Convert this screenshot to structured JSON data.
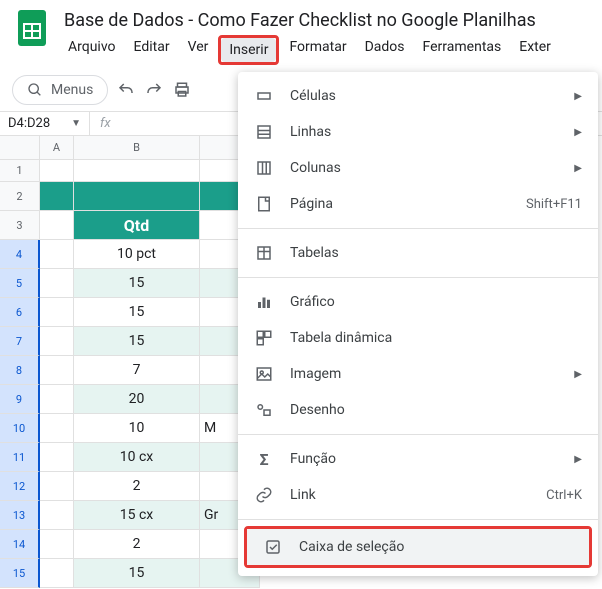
{
  "doc_title": "Base de Dados - Como Fazer Checklist no Google Planilhas",
  "menubar": {
    "arquivo": "Arquivo",
    "editar": "Editar",
    "ver": "Ver",
    "inserir": "Inserir",
    "formatar": "Formatar",
    "dados": "Dados",
    "ferramentas": "Ferramentas",
    "exter": "Exter"
  },
  "toolbar": {
    "menus": "Menus"
  },
  "namebox": "D4:D28",
  "fx_label": "fx",
  "columns": {
    "a": "A",
    "b": "B",
    "c": ""
  },
  "rows": [
    {
      "n": "1",
      "b": "",
      "c": "",
      "cls": "first"
    },
    {
      "n": "2",
      "b": "",
      "c": "",
      "cls": "row2"
    },
    {
      "n": "3",
      "b": "Qtd",
      "c": "",
      "cls": "hdr"
    },
    {
      "n": "4",
      "b": "10 pct",
      "c": "",
      "cls": "sel"
    },
    {
      "n": "5",
      "b": "15",
      "c": "",
      "cls": "sel teal"
    },
    {
      "n": "6",
      "b": "15",
      "c": "",
      "cls": "sel"
    },
    {
      "n": "7",
      "b": "15",
      "c": "",
      "cls": "sel teal"
    },
    {
      "n": "8",
      "b": "7",
      "c": "",
      "cls": "sel"
    },
    {
      "n": "9",
      "b": "20",
      "c": "",
      "cls": "sel teal"
    },
    {
      "n": "10",
      "b": "10",
      "c": "M",
      "cls": "sel"
    },
    {
      "n": "11",
      "b": "10 cx",
      "c": "",
      "cls": "sel teal"
    },
    {
      "n": "12",
      "b": "2",
      "c": "",
      "cls": "sel"
    },
    {
      "n": "13",
      "b": "15 cx",
      "c": "Gr",
      "cls": "sel teal"
    },
    {
      "n": "14",
      "b": "2",
      "c": "",
      "cls": "sel"
    },
    {
      "n": "15",
      "b": "15",
      "c": "",
      "cls": "sel teal"
    }
  ],
  "dropdown": {
    "celulas": "Células",
    "linhas": "Linhas",
    "colunas": "Colunas",
    "pagina": "Página",
    "pagina_shortcut": "Shift+F11",
    "tabelas": "Tabelas",
    "grafico": "Gráfico",
    "tabela_dinamica": "Tabela dinâmica",
    "imagem": "Imagem",
    "desenho": "Desenho",
    "funcao": "Função",
    "link": "Link",
    "link_shortcut": "Ctrl+K",
    "caixa_selecao": "Caixa de seleção"
  }
}
